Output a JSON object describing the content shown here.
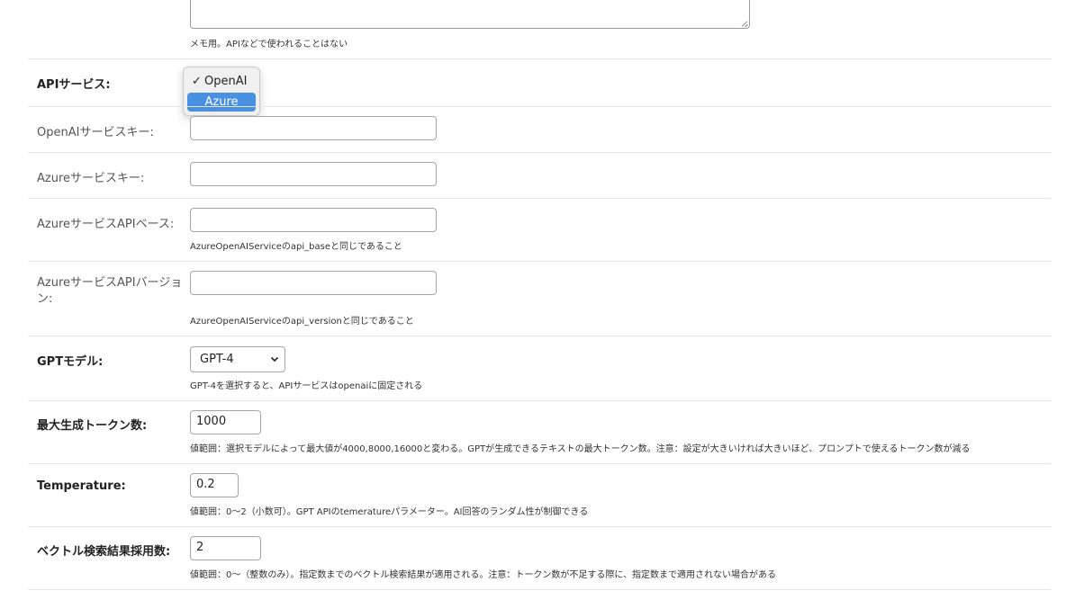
{
  "memo": {
    "help": "メモ用。APIなどで使われることはない"
  },
  "api_service": {
    "label": "APIサービス:",
    "options": [
      {
        "check": "✓",
        "label": "OpenAI"
      },
      {
        "check": "",
        "label": "Azure"
      }
    ]
  },
  "openai_key": {
    "label": "OpenAIサービスキー:",
    "value": ""
  },
  "azure_key": {
    "label": "Azureサービスキー:",
    "value": ""
  },
  "azure_base": {
    "label": "AzureサービスAPIベース:",
    "value": "",
    "help": "AzureOpenAIServiceのapi_baseと同じであること"
  },
  "azure_version": {
    "label_line1": "AzureサービスAPIバージョ",
    "label_line2": "ン:",
    "value": "",
    "help": "AzureOpenAIServiceのapi_versionと同じであること"
  },
  "gpt_model": {
    "label": "GPTモデル:",
    "value": "GPT-4",
    "help": "GPT-4を選択すると、APIサービスはopenaiに固定される"
  },
  "max_tokens": {
    "label": "最大生成トークン数:",
    "value": "1000",
    "help": "値範囲：選択モデルによって最大値が4000,8000,16000と変わる。GPTが生成できるテキストの最大トークン数。注意：設定が大きいければ大きいほど、プロンプトで使えるトークン数が減る"
  },
  "temperature": {
    "label": "Temperature:",
    "value": "0.2",
    "help": "値範囲：0～2（小数可）。GPT APIのtemeratureパラメーター。AI回答のランダム性が制御できる"
  },
  "vector_count": {
    "label": "ベクトル検索結果採用数:",
    "value": "2",
    "help": "値範囲：0～（整数のみ）。指定数までのベクトル検索結果が適用される。注意：トークン数が不足する際に、指定数まで適用されない場合がある"
  }
}
